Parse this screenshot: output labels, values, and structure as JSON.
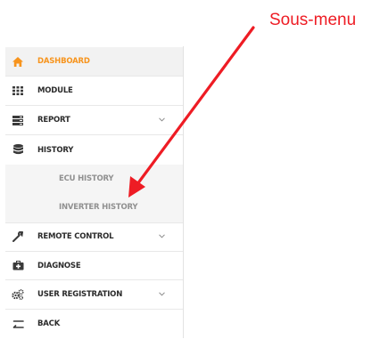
{
  "annotation": {
    "text": "Sous-menu",
    "color": "#ee1c24"
  },
  "colors": {
    "accent": "#f7941d",
    "text": "#2b2b2b",
    "submenu_text": "#909090"
  },
  "sidebar": {
    "items": [
      {
        "label": "DASHBOARD",
        "icon": "home-icon",
        "active": true
      },
      {
        "label": "MODULE",
        "icon": "grid-icon"
      },
      {
        "label": "REPORT",
        "icon": "report-icon",
        "expandable": true
      },
      {
        "label": "HISTORY",
        "icon": "database-icon",
        "expanded": true,
        "submenu": [
          {
            "label": "ECU HISTORY"
          },
          {
            "label": "INVERTER HISTORY"
          }
        ]
      },
      {
        "label": "REMOTE CONTROL",
        "icon": "wrench-icon",
        "expandable": true
      },
      {
        "label": "DIAGNOSE",
        "icon": "medkit-icon"
      },
      {
        "label": "USER REGISTRATION",
        "icon": "gears-icon",
        "expandable": true
      },
      {
        "label": "BACK",
        "icon": "back-arrow-icon"
      }
    ]
  }
}
